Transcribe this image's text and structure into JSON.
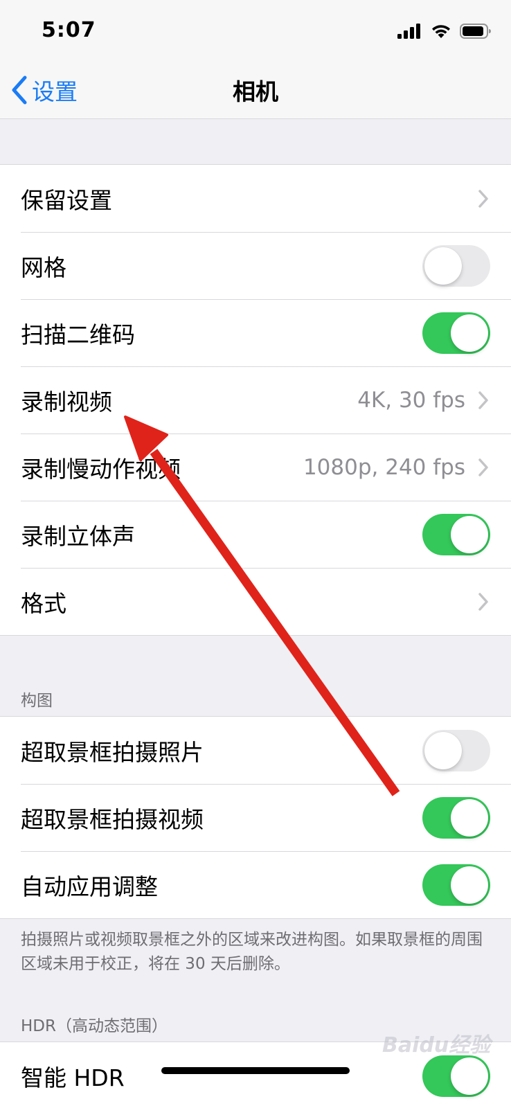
{
  "status_bar": {
    "time": "5:07",
    "icons": [
      "signal-icon",
      "wifi-icon",
      "battery-icon"
    ]
  },
  "nav": {
    "back_label": "设置",
    "title": "相机"
  },
  "group_main": {
    "rows": [
      {
        "label": "保留设置",
        "value": "",
        "control": "chevron"
      },
      {
        "label": "网格",
        "control": "toggle",
        "on": false
      },
      {
        "label": "扫描二维码",
        "control": "toggle",
        "on": true
      },
      {
        "label": "录制视频",
        "value": "4K, 30 fps",
        "control": "chevron"
      },
      {
        "label": "录制慢动作视频",
        "value": "1080p, 240 fps",
        "control": "chevron"
      },
      {
        "label": "录制立体声",
        "control": "toggle",
        "on": true
      },
      {
        "label": "格式",
        "value": "",
        "control": "chevron"
      }
    ]
  },
  "composition": {
    "header": "构图",
    "rows": [
      {
        "label": "超取景框拍摄照片",
        "control": "toggle",
        "on": false
      },
      {
        "label": "超取景框拍摄视频",
        "control": "toggle",
        "on": true
      },
      {
        "label": "自动应用调整",
        "control": "toggle",
        "on": true
      }
    ],
    "footer": "拍摄照片或视频取景框之外的区域来改进构图。如果取景框的周围区域未用于校正，将在 30 天后删除。"
  },
  "hdr": {
    "header": "HDR（高动态范围）",
    "rows": [
      {
        "label": "智能 HDR",
        "control": "toggle",
        "on": true
      }
    ]
  },
  "watermark": "Baidu经验",
  "colors": {
    "accent": "#1a7cf5",
    "toggle_on": "#34c759",
    "annotation_arrow": "#e0231a"
  }
}
